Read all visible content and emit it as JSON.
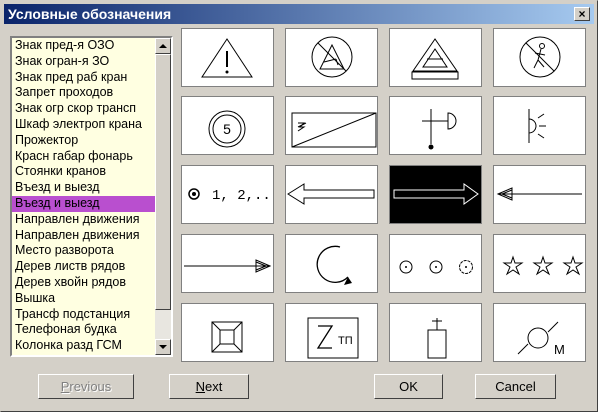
{
  "window": {
    "title": "Условные обозначения",
    "close_label": "×"
  },
  "list": {
    "items": [
      "Знак пред-я ОЗО",
      "Знак огран-я ЗО",
      "Знак пред раб кран",
      "Запрет проходов",
      "Знак огр скор трансп",
      "Шкаф электроп крана",
      "Прожектор",
      "Красн габар фонарь",
      "Стоянки кранов",
      "Въезд и выезд",
      "Въезд и выезд",
      "Направлен движения",
      "Направлен движения",
      "Место разворота",
      "Дерев листв рядов",
      "Дерев хвойн рядов",
      "Вышка",
      "Трансф подстанция",
      "Телефоная будка",
      "Колонка разд ГСМ"
    ],
    "selected_index": 10
  },
  "symbols": {
    "speed_limit_value": "5",
    "parking_label": "1, 2,...",
    "substation_label": "ТП",
    "fuel_label": "М",
    "highlighted_cell": "entry-exit-arrow"
  },
  "buttons": {
    "previous": {
      "first": "P",
      "rest": "revious",
      "enabled": false
    },
    "next": {
      "first": "N",
      "rest": "ext",
      "enabled": true
    },
    "ok": "OK",
    "cancel": "Cancel"
  }
}
